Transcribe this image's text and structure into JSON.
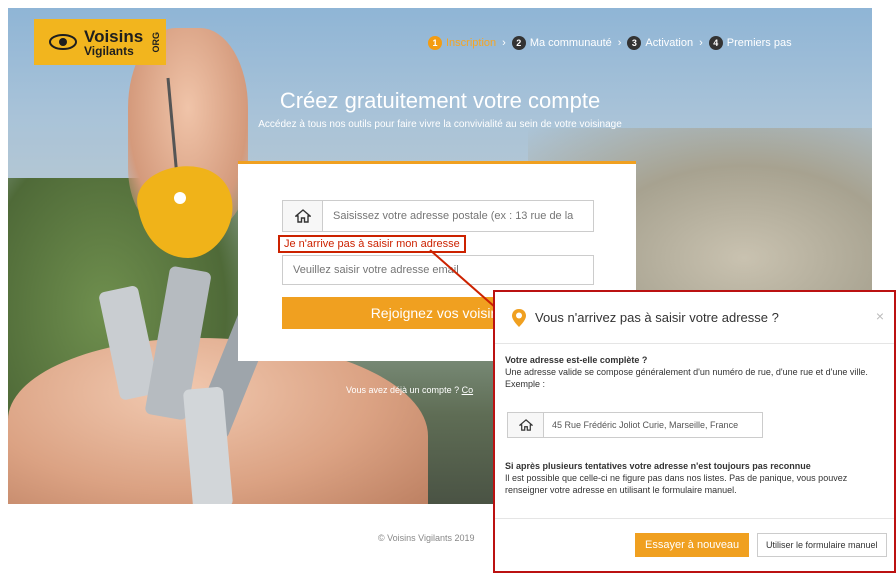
{
  "brand": {
    "name_line1": "Voisins",
    "name_line2": "Vigilants",
    "org": "ORG"
  },
  "steps": [
    {
      "num": "1",
      "label": "Inscription",
      "active": true
    },
    {
      "num": "2",
      "label": "Ma communauté",
      "active": false
    },
    {
      "num": "3",
      "label": "Activation",
      "active": false
    },
    {
      "num": "4",
      "label": "Premiers pas",
      "active": false
    }
  ],
  "hero": {
    "title": "Créez gratuitement votre compte",
    "subtitle": "Accédez à tous nos outils pour faire vivre la convivialité au sein de votre voisinage"
  },
  "form": {
    "address_placeholder": "Saisissez votre adresse postale (ex : 13 rue de la",
    "address_error_link": "Je n'arrive pas à saisir mon adresse",
    "email_placeholder": "Veuillez saisir votre adresse email",
    "join_button": "Rejoignez vos voisins"
  },
  "already_account": {
    "text": "Vous avez déjà un compte ?",
    "link": "Co"
  },
  "footer": {
    "copyright": "© Voisins Vigilants 2019"
  },
  "modal": {
    "title": "Vous n'arrivez pas à saisir votre adresse ?",
    "close": "×",
    "q1_title": "Votre adresse est-elle complète ?",
    "q1_text": "Une adresse valide se compose généralement d'un numéro de rue, d'une rue et d'une ville.",
    "example_label": "Exemple :",
    "example_value": "45 Rue Frédéric Joliot Curie, Marseille, France",
    "q2_title": "Si après plusieurs tentatives votre adresse n'est toujours pas reconnue",
    "q2_text": "Il est possible que celle-ci ne figure pas dans nos listes. Pas de panique, vous pouvez renseigner votre adresse en utilisant le formulaire manuel.",
    "retry_button": "Essayer à nouveau",
    "manual_button": "Utiliser le formulaire manuel"
  },
  "colors": {
    "accent": "#f0a020",
    "error": "#cc2200",
    "logo_bg": "#f2b51e"
  }
}
